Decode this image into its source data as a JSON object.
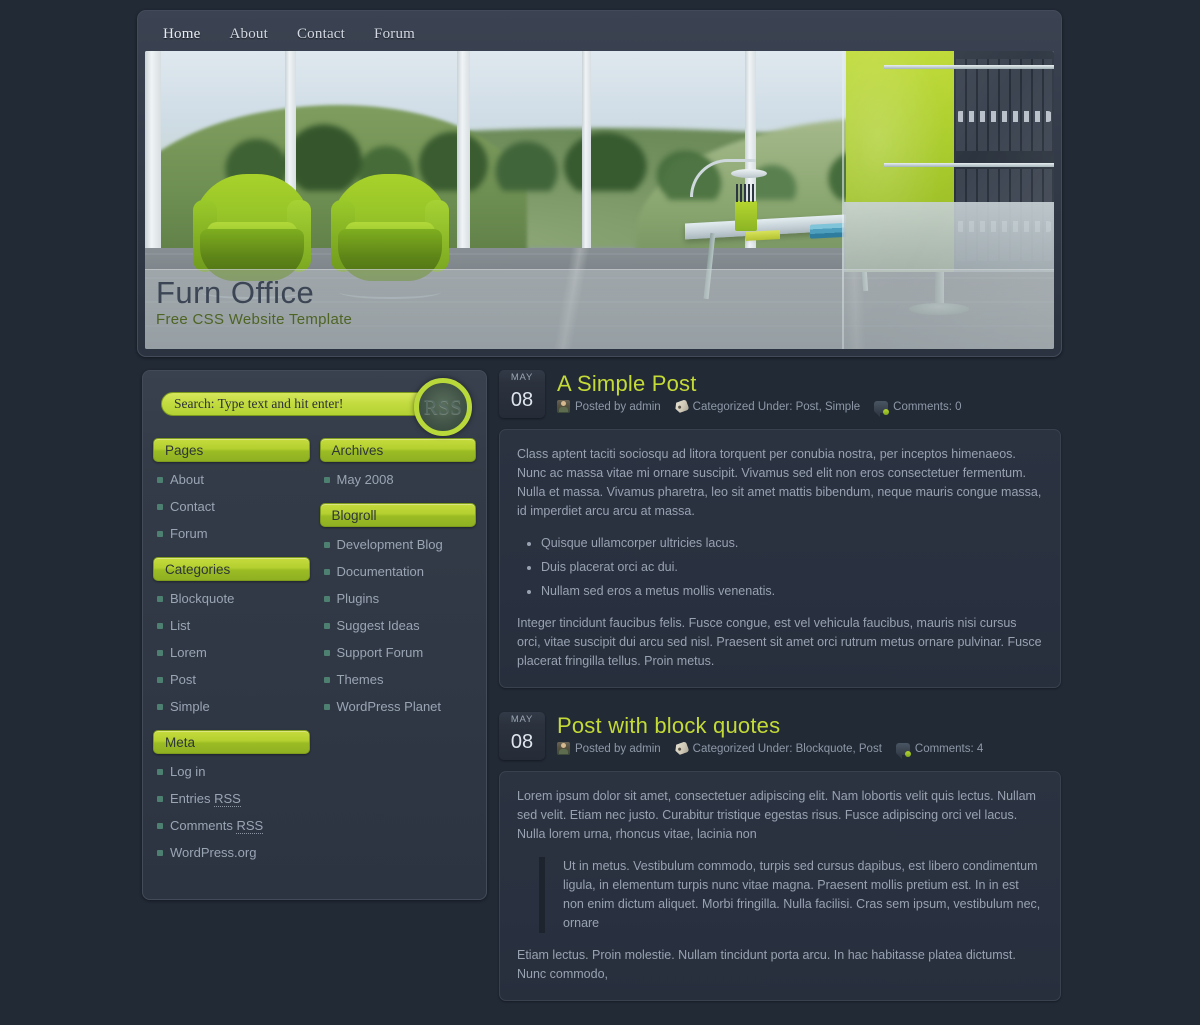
{
  "nav": {
    "items": [
      {
        "label": "Home"
      },
      {
        "label": "About"
      },
      {
        "label": "Contact"
      },
      {
        "label": "Forum"
      }
    ]
  },
  "header": {
    "title": "Furn Office",
    "tagline": "Free CSS Website Template"
  },
  "sidebar": {
    "search": {
      "placeholder": "Search: Type text and hit enter!",
      "value": ""
    },
    "rss": {
      "label": "RSS"
    },
    "left_widgets": [
      {
        "title": "Pages",
        "items": [
          {
            "label": "About"
          },
          {
            "label": "Contact"
          },
          {
            "label": "Forum"
          }
        ]
      },
      {
        "title": "Categories",
        "items": [
          {
            "label": "Blockquote"
          },
          {
            "label": "List"
          },
          {
            "label": "Lorem"
          },
          {
            "label": "Post"
          },
          {
            "label": "Simple"
          }
        ]
      },
      {
        "title": "Meta",
        "items": [
          {
            "label": "Log in"
          },
          {
            "label": "Entries ",
            "abbr": "RSS"
          },
          {
            "label": "Comments ",
            "abbr": "RSS"
          },
          {
            "label": "WordPress.org"
          }
        ]
      }
    ],
    "right_widgets": [
      {
        "title": "Archives",
        "items": [
          {
            "label": "May 2008"
          }
        ]
      },
      {
        "title": "Blogroll",
        "items": [
          {
            "label": "Development Blog"
          },
          {
            "label": "Documentation"
          },
          {
            "label": "Plugins"
          },
          {
            "label": "Suggest Ideas"
          },
          {
            "label": "Support Forum"
          },
          {
            "label": "Themes"
          },
          {
            "label": "WordPress Planet"
          }
        ]
      }
    ]
  },
  "posts": [
    {
      "date_month": "MAY",
      "date_day": "08",
      "title": "A Simple Post",
      "author_label": "Posted by admin",
      "categories_label": "Categorized Under: Post, Simple",
      "comments_label": "Comments: 0",
      "paragraph1": "Class aptent taciti sociosqu ad litora torquent per conubia nostra, per inceptos himenaeos. Nunc ac massa vitae mi ornare suscipit. Vivamus sed elit non eros consectetuer fermentum. Nulla et massa. Vivamus pharetra, leo sit amet mattis bibendum, neque mauris congue massa, id imperdiet arcu arcu at massa.",
      "list": [
        "Quisque ullamcorper ultricies lacus.",
        "Duis placerat orci ac dui.",
        "Nullam sed eros a metus mollis venenatis."
      ],
      "paragraph2": "Integer tincidunt faucibus felis. Fusce congue, est vel vehicula faucibus, mauris nisi cursus orci, vitae suscipit dui arcu sed nisl. Praesent sit amet orci rutrum metus ornare pulvinar. Fusce placerat fringilla tellus. Proin metus."
    },
    {
      "date_month": "MAY",
      "date_day": "08",
      "title": "Post with block quotes",
      "author_label": "Posted by admin",
      "categories_label": "Categorized Under: Blockquote, Post",
      "comments_label": "Comments: 4",
      "paragraph1": "Lorem ipsum dolor sit amet, consectetuer adipiscing elit. Nam lobortis velit quis lectus. Nullam sed velit. Etiam nec justo. Curabitur tristique egestas risus. Fusce adipiscing orci vel lacus. Nulla lorem urna, rhoncus vitae, lacinia non",
      "quote": "Ut in metus. Vestibulum commodo, turpis sed cursus dapibus, est libero condimentum ligula, in elementum turpis nunc vitae magna. Praesent mollis pretium est. In in est non enim dictum aliquet. Morbi fringilla. Nulla facilisi. Cras sem ipsum, vestibulum nec, ornare",
      "paragraph2": "Etiam lectus. Proin molestie. Nullam tincidunt porta arcu. In hac habitasse platea dictumst. Nunc commodo,"
    }
  ],
  "colors": {
    "page_background": "#222a36",
    "accent_green": "#b3cf2f",
    "post_title": "#c4da35",
    "tagline": "#4e6423",
    "body_text": "#98a2b1",
    "panel": "#2b3341"
  }
}
